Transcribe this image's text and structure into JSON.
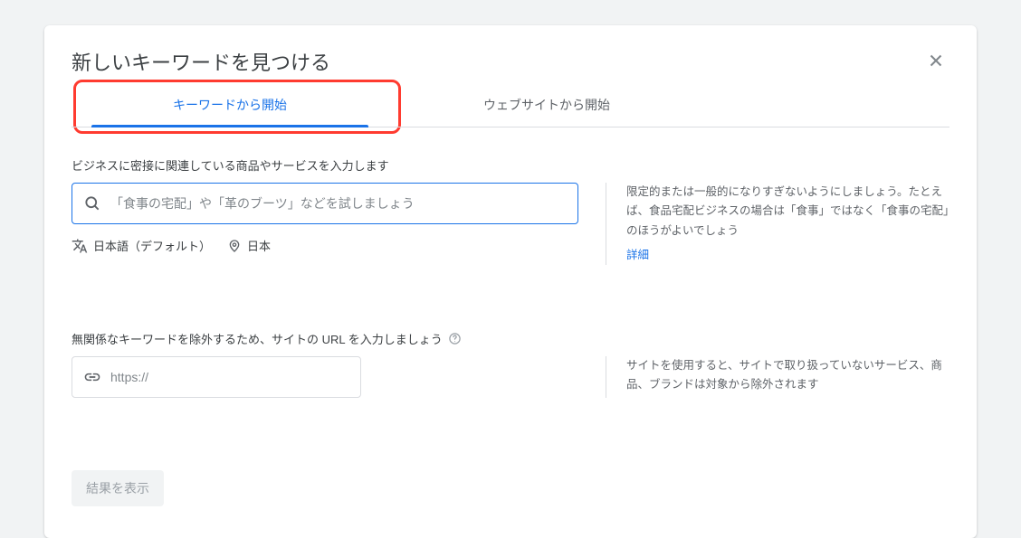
{
  "header": {
    "title": "新しいキーワードを見つける"
  },
  "tabs": {
    "start_with_keywords": "キーワードから開始",
    "start_with_website": "ウェブサイトから開始"
  },
  "keyword_section": {
    "label": "ビジネスに密接に関連している商品やサービスを入力します",
    "placeholder": "「食事の宅配」や「革のブーツ」などを試しましょう",
    "language": "日本語（デフォルト）",
    "location": "日本",
    "help_text": "限定的または一般的になりすぎないようにしましょう。たとえば、食品宅配ビジネスの場合は「食事」ではなく「食事の宅配」のほうがよいでしょう",
    "details_link": "詳細"
  },
  "url_section": {
    "label": "無関係なキーワードを除外するため、サイトの URL を入力しましょう",
    "placeholder": "https://",
    "help_text": "サイトを使用すると、サイトで取り扱っていないサービス、商品、ブランドは対象から除外されます"
  },
  "submit": {
    "label": "結果を表示"
  }
}
